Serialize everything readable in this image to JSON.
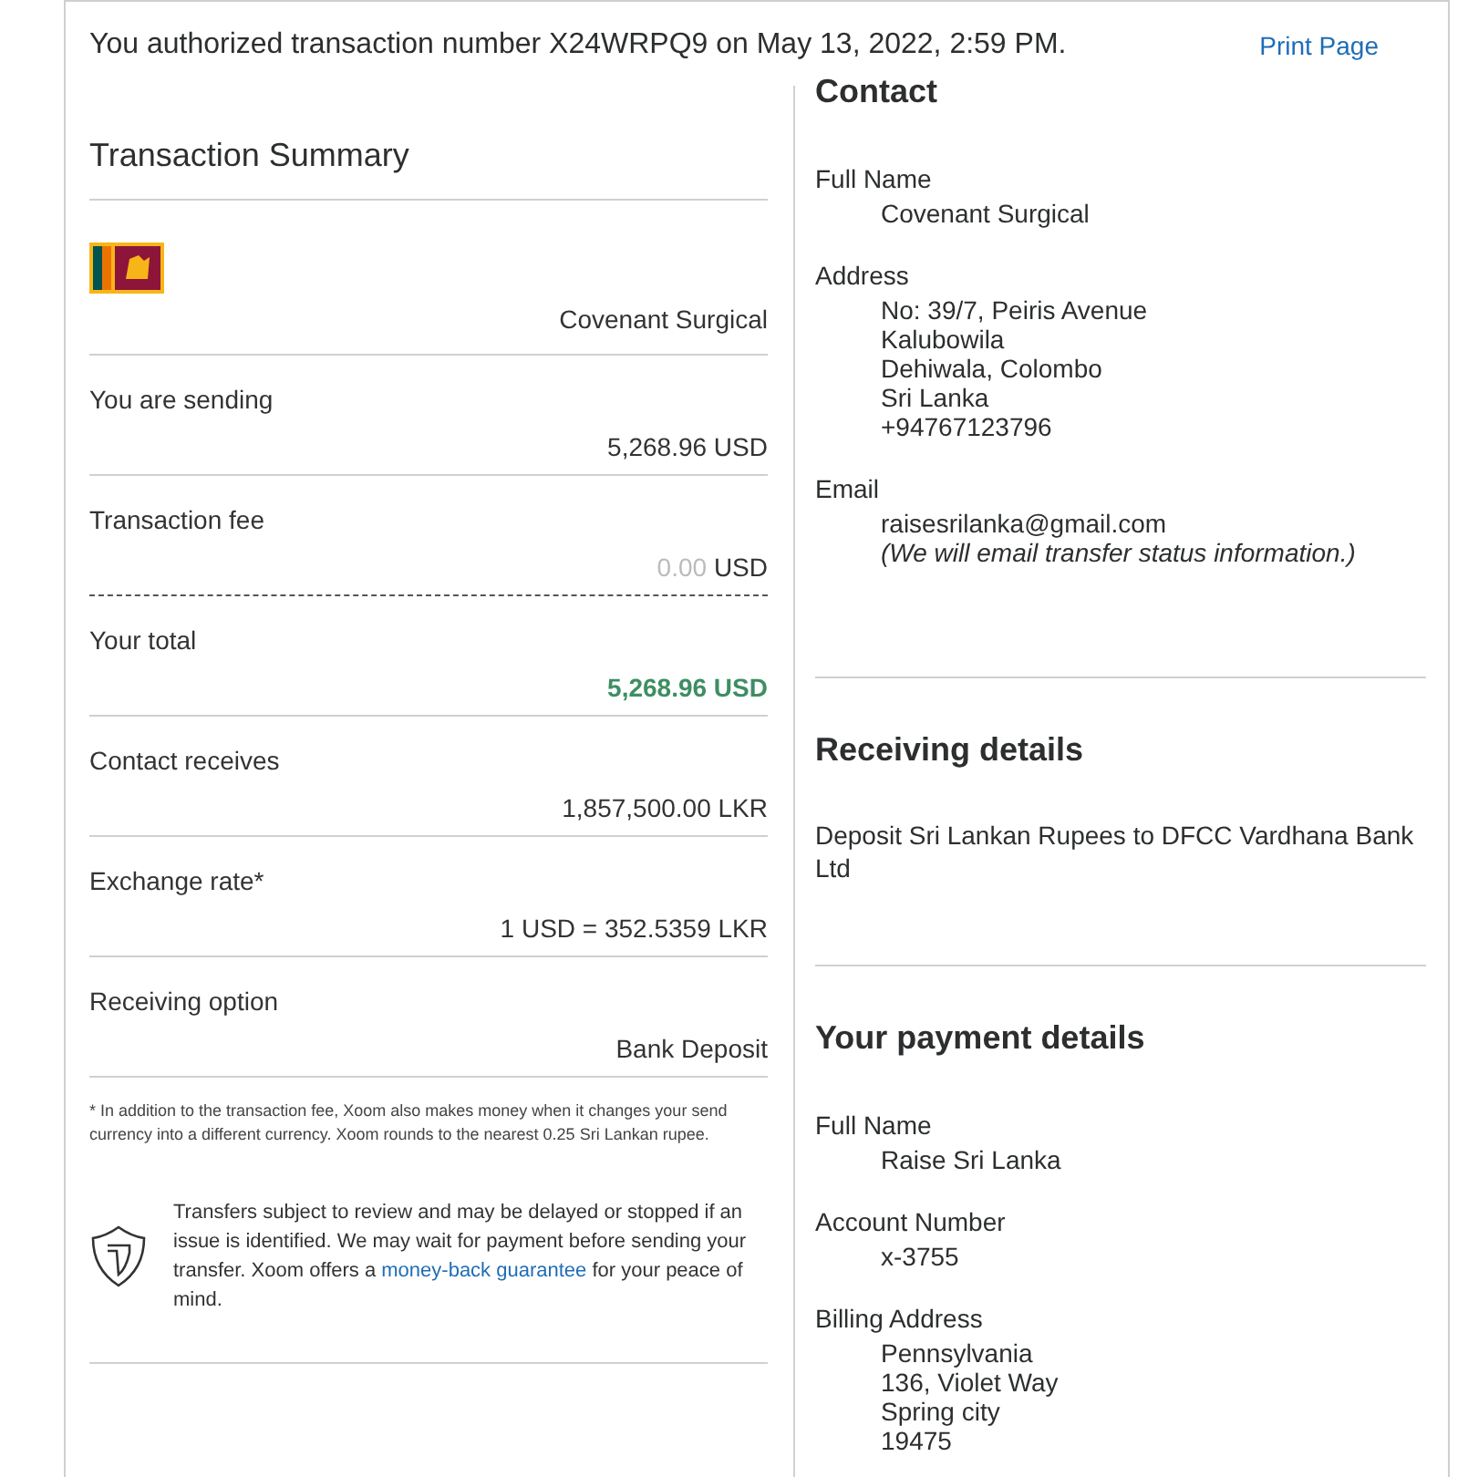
{
  "header": {
    "title": "You authorized transaction number X24WRPQ9 on May 13, 2022, 2:59 PM.",
    "print_link": "Print Page"
  },
  "summary": {
    "title": "Transaction Summary",
    "recipient": "Covenant Surgical",
    "rows": [
      {
        "kind": "plain",
        "label": "You are sending",
        "value": "5,268.96 USD"
      },
      {
        "kind": "fee",
        "label": "Transaction fee",
        "amount": "0.00",
        "currency": "USD"
      },
      {
        "kind": "total",
        "label": "Your total",
        "value": "5,268.96 USD"
      },
      {
        "kind": "plain",
        "label": "Contact receives",
        "value": "1,857,500.00 LKR"
      },
      {
        "kind": "plain",
        "label": "Exchange rate*",
        "value": "1 USD = 352.5359 LKR"
      },
      {
        "kind": "plain",
        "label": "Receiving option",
        "value": "Bank Deposit"
      }
    ],
    "footnote": "* In addition to the transaction fee, Xoom also makes money when it changes your send currency into a different currency. Xoom rounds to the nearest 0.25 Sri Lankan rupee.",
    "guarantee": {
      "text_before": "Transfers subject to review and may be delayed or stopped if an issue is identified. We may wait for payment before sending your transfer. Xoom offers a",
      "link": "money-back guarantee",
      "text_after": "for your peace of mind."
    }
  },
  "sections": [
    {
      "kind": "fields",
      "title": "Contact",
      "fields": [
        {
          "label": "Full Name",
          "lines": [
            "Covenant Surgical"
          ]
        },
        {
          "label": "Address",
          "lines": [
            "No: 39/7, Peiris Avenue",
            "Kalubowila",
            "Dehiwala, Colombo",
            "Sri Lanka",
            "+94767123796"
          ]
        },
        {
          "label": "Email",
          "lines": [
            "raisesrilanka@gmail.com"
          ],
          "note": "(We will email transfer status information.)"
        }
      ]
    },
    {
      "kind": "text",
      "title": "Receiving details",
      "text": "Deposit Sri Lankan Rupees to DFCC Vardhana Bank Ltd"
    },
    {
      "kind": "fields",
      "title": "Your payment details",
      "fields": [
        {
          "label": "Full Name",
          "lines": [
            "Raise Sri Lanka"
          ]
        },
        {
          "label": "Account Number",
          "lines": [
            "x-3755"
          ]
        },
        {
          "label": "Billing Address",
          "lines": [
            "Pennsylvania",
            "136, Violet Way",
            "Spring city",
            "19475"
          ]
        }
      ]
    }
  ]
}
